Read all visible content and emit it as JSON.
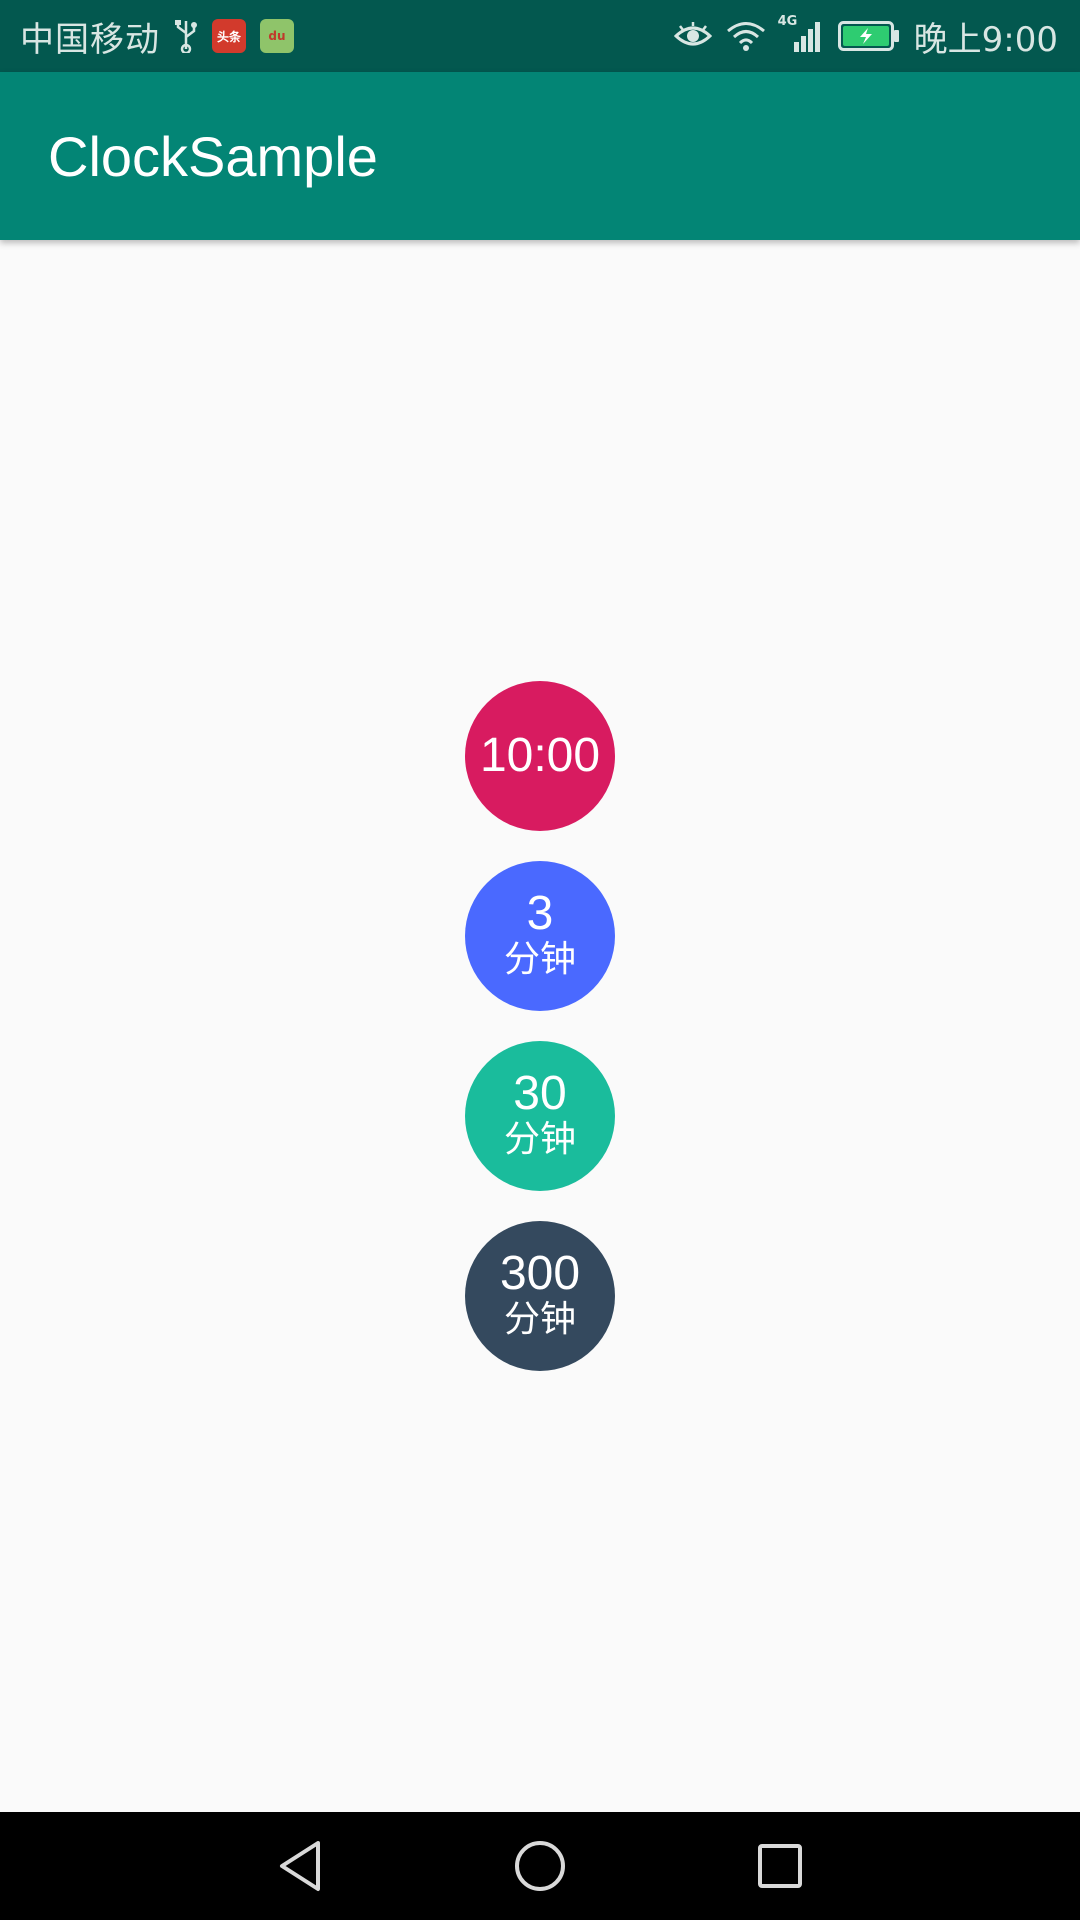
{
  "status_bar": {
    "carrier": "中国移动",
    "notification_icons": [
      "usb-icon",
      "toutiao-news-icon",
      "baidu-map-icon"
    ],
    "news_icon_text": "头条",
    "map_icon_text": "du",
    "network_type": "4G",
    "time": "晚上9:00",
    "battery": "charging",
    "battery_accent": "#2ecc71"
  },
  "app_bar": {
    "title": "ClockSample",
    "color": "#038575"
  },
  "circles": [
    {
      "value": "10:00",
      "unit": "",
      "color": "#d81b60"
    },
    {
      "value": "3",
      "unit": "分钟",
      "color": "#4a69ff"
    },
    {
      "value": "30",
      "unit": "分钟",
      "color": "#1abc9c"
    },
    {
      "value": "300",
      "unit": "分钟",
      "color": "#34495e"
    }
  ],
  "nav_bar": {
    "buttons": [
      "back-icon",
      "home-icon",
      "recent-apps-icon"
    ]
  }
}
